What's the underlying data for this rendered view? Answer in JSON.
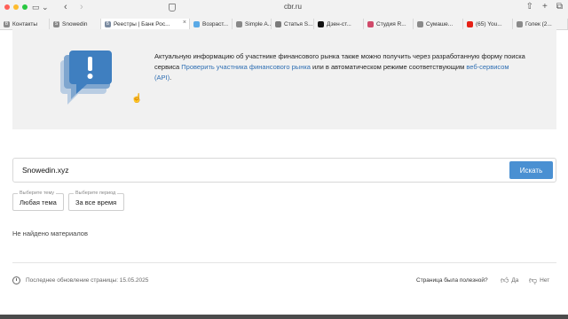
{
  "browser": {
    "url": "cbr.ru",
    "tabs": [
      {
        "label": "Контакты",
        "favicon": "В",
        "color": "#8a8a8a"
      },
      {
        "label": "Snowedin",
        "favicon": "S",
        "color": "#8a8a8a"
      },
      {
        "label": "Реестры | Банк Рос...",
        "favicon": "Б",
        "color": "#7a8aa0",
        "active": true
      },
      {
        "label": "Возраст...",
        "favicon": "",
        "color": "#5aa9e6"
      },
      {
        "label": "Simple A...",
        "favicon": "",
        "color": "#888888"
      },
      {
        "label": "Статья S...",
        "favicon": "",
        "color": "#7a7a7a"
      },
      {
        "label": "Дзен-ст...",
        "favicon": "",
        "color": "#111111"
      },
      {
        "label": "Студия R...",
        "favicon": "",
        "color": "#d04a6a"
      },
      {
        "label": "Сумаше...",
        "favicon": "",
        "color": "#8a8a8a"
      },
      {
        "label": "(65) You...",
        "favicon": "",
        "color": "#e62117"
      },
      {
        "label": "Голек (2...",
        "favicon": "",
        "color": "#8a8a8a"
      }
    ]
  },
  "banner": {
    "text_before": "Актуальную информацию об участнике финансового рынка также можно получить через разработанную форму поиска сервиса ",
    "link1": "Проверить участника финансового рынка",
    "text_middle": " или в автоматическом режиме соответствующим ",
    "link2": "веб-сервисом (API)",
    "text_after": "."
  },
  "search": {
    "value": "Snowedin.xyz",
    "button": "Искать"
  },
  "filters": [
    {
      "label": "Выберите тему",
      "value": "Любая тема"
    },
    {
      "label": "Выберите период",
      "value": "За все время"
    }
  ],
  "results": {
    "empty_text": "Не найдено материалов"
  },
  "footer": {
    "updated": "Последнее обновление страницы: 15.05.2025",
    "useful_question": "Страница была полезной?",
    "yes": "Да",
    "no": "Нет"
  },
  "colors": {
    "accent": "#4a90d2",
    "link": "#2f6fb3",
    "banner_bg": "#f1f1f1"
  }
}
